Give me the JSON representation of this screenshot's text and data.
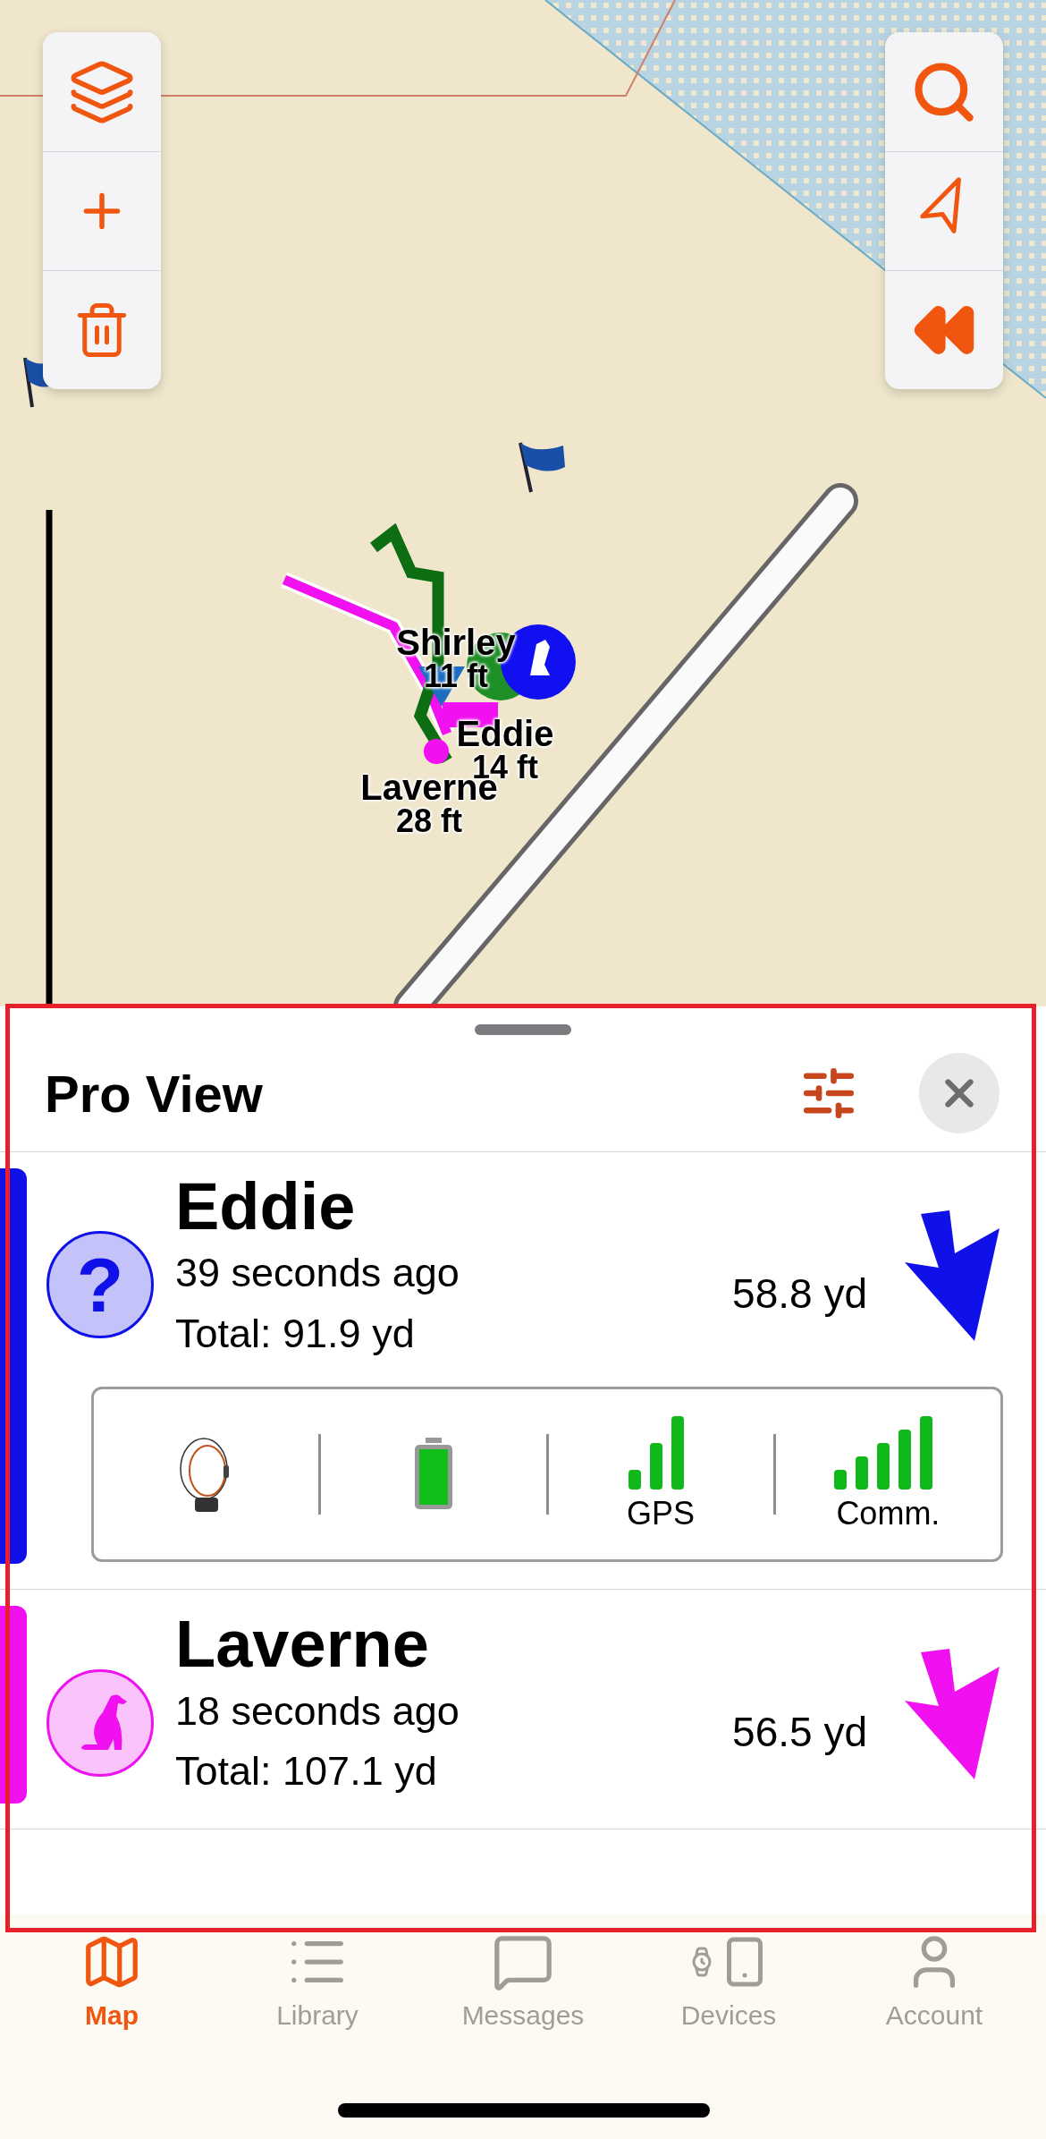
{
  "map": {
    "markers": [
      {
        "name": "Shirley",
        "distance": "11 ft"
      },
      {
        "name": "Eddie",
        "distance": "14 ft"
      },
      {
        "name": "Laverne",
        "distance": "28 ft"
      }
    ]
  },
  "panel": {
    "title": "Pro View",
    "dogs": [
      {
        "name": "Eddie",
        "color": "#1010e8",
        "avatar": {
          "kind": "unknown",
          "symbol": "?"
        },
        "last_seen": "39 seconds ago",
        "total": "Total: 91.9 yd",
        "distance": "58.8 yd",
        "status": {
          "gps_label": "GPS",
          "comm_label": "Comm."
        }
      },
      {
        "name": "Laverne",
        "color": "#f010f0",
        "avatar": {
          "kind": "dog"
        },
        "last_seen": "18 seconds ago",
        "total": "Total: 107.1 yd",
        "distance": "56.5 yd"
      }
    ]
  },
  "tabs": [
    {
      "label": "Map",
      "selected": true
    },
    {
      "label": "Library",
      "selected": false
    },
    {
      "label": "Messages",
      "selected": false
    },
    {
      "label": "Devices",
      "selected": false
    },
    {
      "label": "Account",
      "selected": false
    }
  ]
}
